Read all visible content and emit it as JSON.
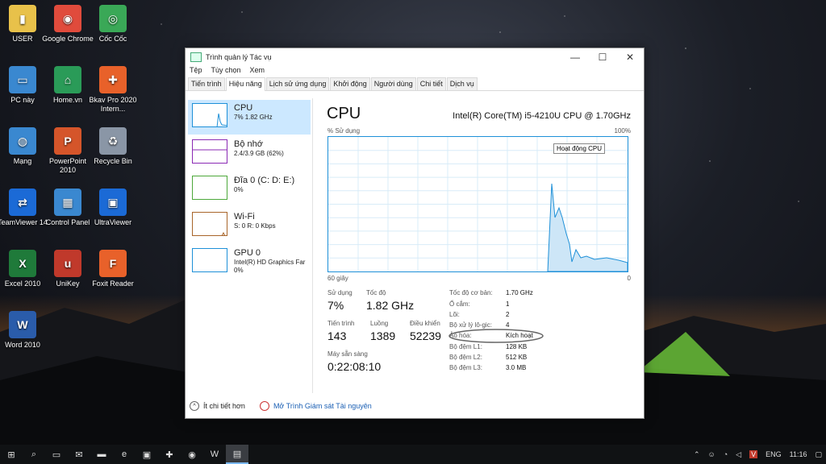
{
  "desktop_icons": [
    {
      "label": "USER",
      "icon": "user-folder-icon",
      "color": "#e8c14a"
    },
    {
      "label": "Google Chrome",
      "icon": "chrome-icon",
      "color": "#e04b3c"
    },
    {
      "label": "Cốc Cốc",
      "icon": "coccoc-icon",
      "color": "#3aa857"
    },
    {
      "label": "PC này",
      "icon": "computer-icon",
      "color": "#3a88d0"
    },
    {
      "label": "Home.vn",
      "icon": "homevn-icon",
      "color": "#2a9b58"
    },
    {
      "label": "Bkav Pro 2020 Intern...",
      "icon": "bkav-icon",
      "color": "#e8612a"
    },
    {
      "label": "Mạng",
      "icon": "network-icon",
      "color": "#3a88d0"
    },
    {
      "label": "PowerPoint 2010",
      "icon": "powerpoint-icon",
      "color": "#d5552a"
    },
    {
      "label": "Recycle Bin",
      "icon": "recycle-bin-icon",
      "color": "#8a96a6"
    },
    {
      "label": "TeamViewer 14",
      "icon": "teamviewer-icon",
      "color": "#1b6ad6"
    },
    {
      "label": "Control Panel",
      "icon": "control-panel-icon",
      "color": "#3a88d0"
    },
    {
      "label": "UltraViewer",
      "icon": "ultraviewer-icon",
      "color": "#1b6ad6"
    },
    {
      "label": "Excel 2010",
      "icon": "excel-icon",
      "color": "#1f7a3a"
    },
    {
      "label": "UniKey",
      "icon": "unikey-icon",
      "color": "#c0392b"
    },
    {
      "label": "Foxit Reader",
      "icon": "foxit-icon",
      "color": "#e8612a"
    },
    {
      "label": "Word 2010",
      "icon": "word-icon",
      "color": "#2a5caa"
    }
  ],
  "window": {
    "title": "Trình quản lý Tác vụ",
    "minimize": "—",
    "maximize": "☐",
    "close": "✕",
    "menu": [
      "Tệp",
      "Tùy chọn",
      "Xem"
    ],
    "tabs": [
      "Tiến trình",
      "Hiệu năng",
      "Lịch sử ứng dụng",
      "Khởi động",
      "Người dùng",
      "Chi tiết",
      "Dịch vụ"
    ],
    "active_tab": "Hiệu năng"
  },
  "resources": [
    {
      "name": "CPU",
      "detail": "7% 1.82 GHz",
      "color": "#1e90d8",
      "selected": true
    },
    {
      "name": "Bộ nhớ",
      "detail": "2.4/3.9 GB (62%)",
      "color": "#8b2ab4",
      "selected": false
    },
    {
      "name": "Đĩa 0 (C: D: E:)",
      "detail": "0%",
      "color": "#4da83a",
      "selected": false
    },
    {
      "name": "Wi-Fi",
      "detail": "S: 0 R: 0 Kbps",
      "color": "#a8652a",
      "selected": false
    },
    {
      "name": "GPU 0",
      "detail": "Intel(R) HD Graphics Far",
      "detail2": "0%",
      "color": "#1e90d8",
      "selected": false
    }
  ],
  "cpu": {
    "title": "CPU",
    "model": "Intel(R) Core(TM) i5-4210U CPU @ 1.70GHz",
    "usage_label": "% Sử dụng",
    "max_label": "100%",
    "time_label": "60 giây",
    "zero_label": "0",
    "tooltip": "Hoạt động CPU",
    "graph_color": "#1e90d8",
    "stats": {
      "usage_label": "Sử dụng",
      "usage": "7%",
      "speed_label": "Tốc độ",
      "speed": "1.82 GHz",
      "processes_label": "Tiến trình",
      "processes": "143",
      "threads_label": "Luồng",
      "threads": "1389",
      "handles_label": "Điều khiển",
      "handles": "52239",
      "uptime_label": "Máy sẵn sàng",
      "uptime": "0:22:08:10"
    },
    "specs": [
      {
        "label": "Tốc độ cơ bản:",
        "value": "1.70 GHz"
      },
      {
        "label": "Ổ cắm:",
        "value": "1"
      },
      {
        "label": "Lõi:",
        "value": "2"
      },
      {
        "label": "Bộ xử lý lô-gic:",
        "value": "4"
      },
      {
        "label": "Ảo hóa:",
        "value": "Kích hoạt"
      },
      {
        "label": "Bộ đệm L1:",
        "value": "128 KB"
      },
      {
        "label": "Bộ đệm L2:",
        "value": "512 KB"
      },
      {
        "label": "Bộ đệm L3:",
        "value": "3.0 MB"
      }
    ]
  },
  "footer": {
    "fewer_details": "Ít chi tiết hơn",
    "open_monitor": "Mở Trình Giám sát Tài nguyên"
  },
  "taskbar": {
    "items": [
      "windows-start-icon",
      "search-icon",
      "task-view-icon",
      "mail-icon",
      "file-explorer-icon",
      "edge-icon",
      "store-icon",
      "bkav-icon",
      "chrome-icon",
      "word-icon",
      "task-manager-icon"
    ],
    "lang": "ENG",
    "time": "11:16"
  }
}
